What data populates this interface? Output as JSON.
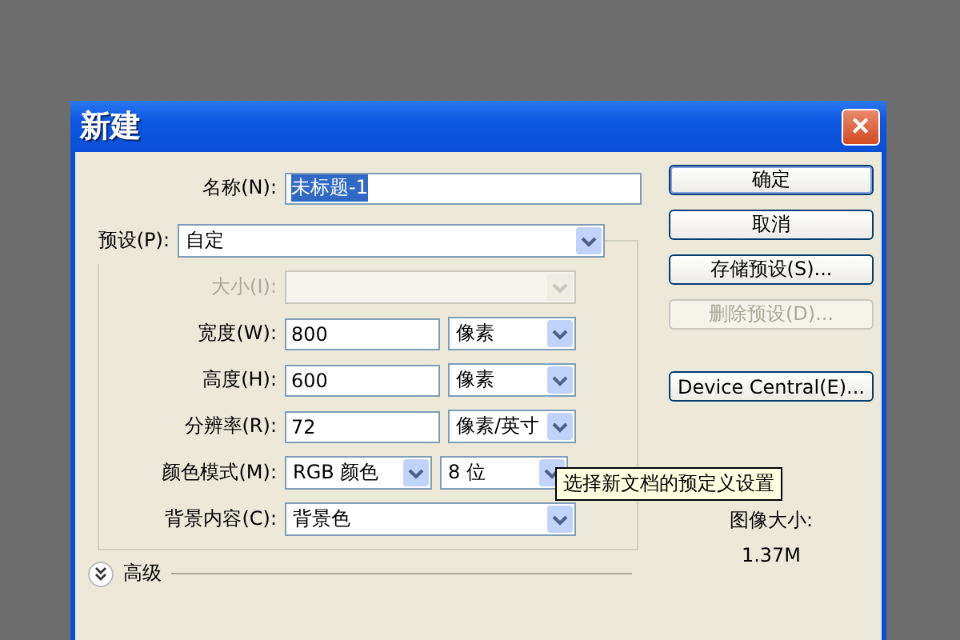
{
  "window": {
    "title": "新建",
    "close": "✕"
  },
  "name": {
    "label": "名称(N):",
    "value": "未标题-1",
    "text_selected": true
  },
  "preset": {
    "label": "预设(P):",
    "value": "自定"
  },
  "fields": [
    {
      "kind": "select",
      "label": "大小(I):",
      "disabled": true
    },
    {
      "kind": "number",
      "label": "宽度(W):",
      "value": "800",
      "unit": "像素"
    },
    {
      "kind": "number",
      "label": "高度(H):",
      "value": "600",
      "unit": "像素"
    },
    {
      "kind": "number",
      "label": "分辨率(R):",
      "value": "72",
      "unit": "像素/英寸"
    },
    {
      "kind": "pair",
      "label": "颜色模式(M):",
      "value": "RGB 颜色",
      "unit": "8 位"
    },
    {
      "kind": "select",
      "label": "背景内容(C):",
      "value": "背景色",
      "disabled": false
    }
  ],
  "advanced": {
    "label": "高级",
    "expanded": false
  },
  "buttons": [
    {
      "label": "确定",
      "disabled": false,
      "default": true
    },
    {
      "label": "取消",
      "disabled": false,
      "default": false
    },
    {
      "label": "存储预设(S)...",
      "disabled": false,
      "default": false
    },
    {
      "label": "删除预设(D)...",
      "disabled": true,
      "default": false
    },
    {
      "label": "Device Central(E)...",
      "disabled": false,
      "default": false
    }
  ],
  "image_size": {
    "label": "图像大小:",
    "value": "1.37M"
  },
  "tooltip": "选择新文档的预定义设置"
}
